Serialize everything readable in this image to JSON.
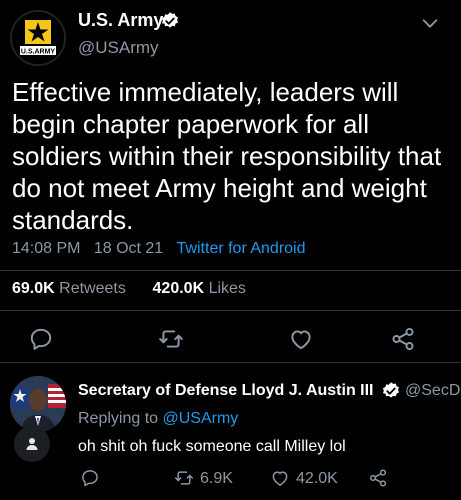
{
  "tweet": {
    "display_name": "U.S. Army",
    "handle": "@USArmy",
    "avatar_text": "U.S.ARMY",
    "text": "Effective immediately, leaders will begin chapter paperwork for all soldiers within their responsibility that do not meet Army height and weight standards.",
    "time": "14:08 PM",
    "date": "18 Oct 21",
    "source": "Twitter for Android",
    "retweets_count": "69.0K",
    "retweets_label": "Retweets",
    "likes_count": "420.0K",
    "likes_label": "Likes"
  },
  "reply": {
    "display_name": "Secretary of Defense Lloyd J. Austin III",
    "handle": "@SecDef",
    "replying_prefix": "Replying to",
    "replying_to": "@USArmy",
    "text": "oh shit oh fuck someone call Milley lol",
    "retweets_count": "6.9K",
    "likes_count": "42.0K"
  },
  "colors": {
    "background": "#000000",
    "text": "#ffffff",
    "muted": "#8b98a5",
    "link": "#1d9bf0",
    "divider": "#2f3336"
  },
  "icons": {
    "verified": "verified-badge-icon",
    "more": "chevron-down-icon",
    "reply": "reply-icon",
    "retweet": "retweet-icon",
    "like": "heart-icon",
    "share": "share-icon"
  }
}
